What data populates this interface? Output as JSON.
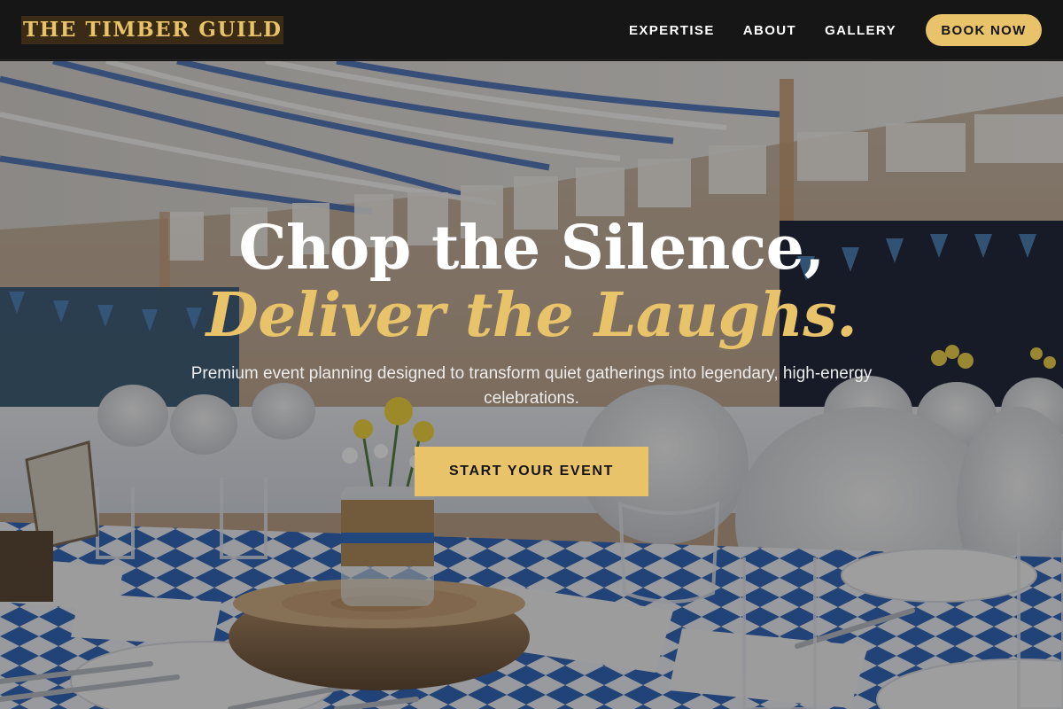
{
  "brand": {
    "logo_text": "THE TIMBER GUILD"
  },
  "nav": {
    "links": [
      {
        "label": "EXPERTISE"
      },
      {
        "label": "ABOUT"
      },
      {
        "label": "GALLERY"
      }
    ],
    "book_label": "BOOK NOW"
  },
  "hero": {
    "headline_line1": "Chop the Silence,",
    "headline_line2": "Deliver the Laughs.",
    "subtitle": "Premium event planning designed to transform quiet gatherings into legendary, high-energy celebrations.",
    "cta_label": "START YOUR EVENT",
    "background_image": "banquet-hall-photo"
  },
  "colors": {
    "accent": "#e8c36a",
    "nav_background": "#161616",
    "logo_background": "#3a2b16",
    "text_light": "#ffffff"
  }
}
